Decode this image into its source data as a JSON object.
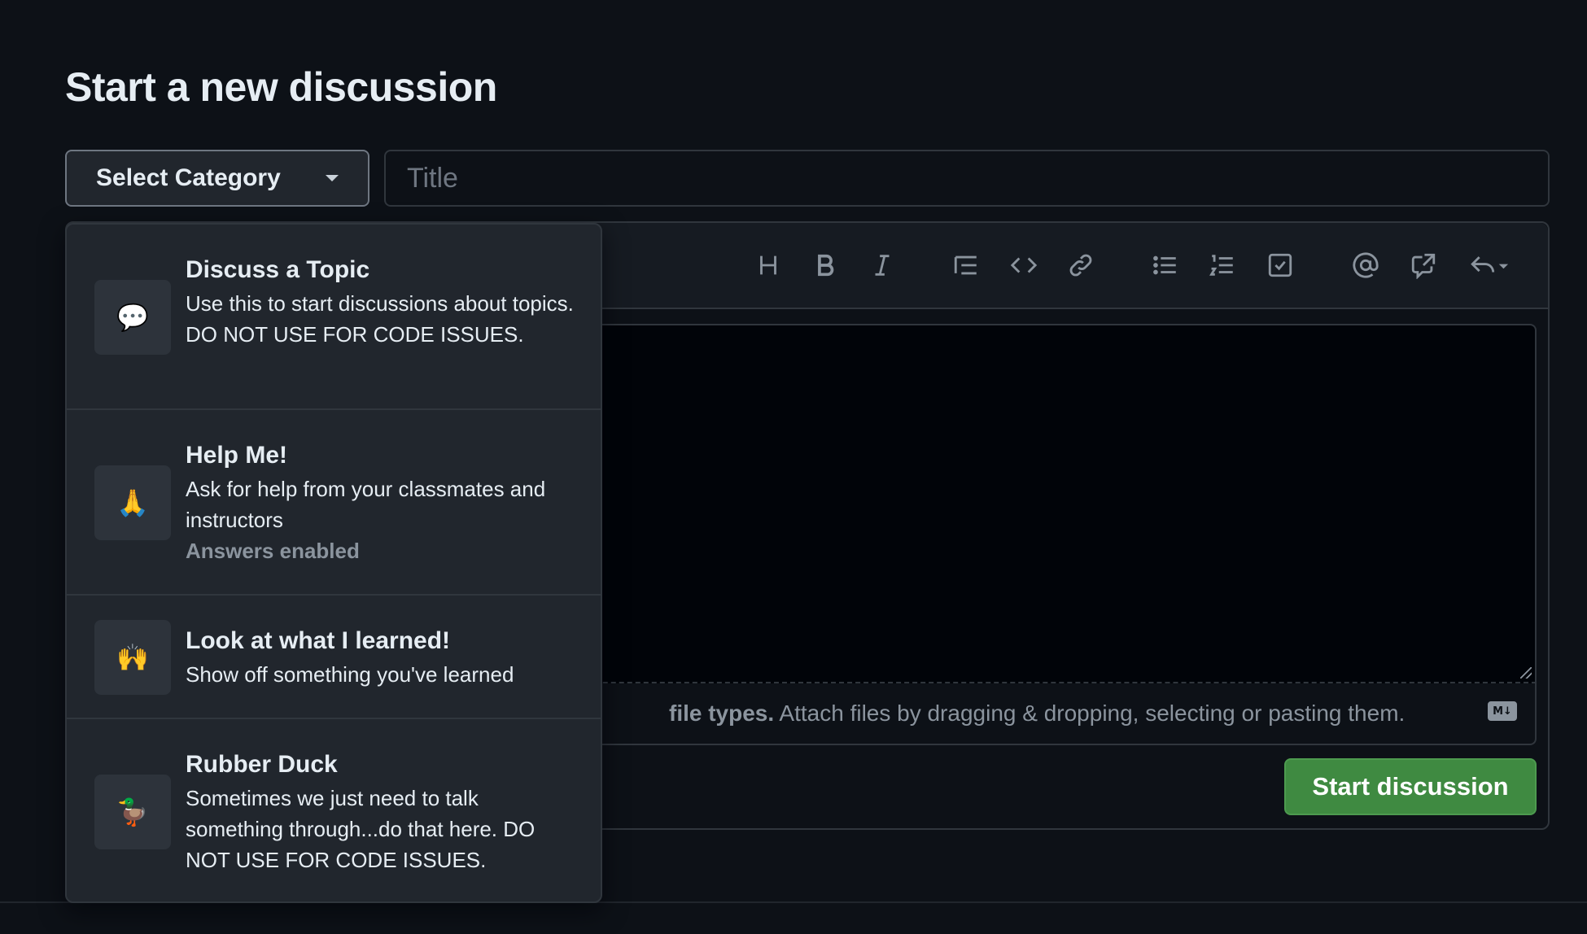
{
  "page": {
    "title": "Start a new discussion"
  },
  "form": {
    "category_button_label": "Select Category",
    "title_placeholder": "Title",
    "submit_label": "Start discussion"
  },
  "toolbar": {
    "tools": [
      "heading-icon",
      "bold-icon",
      "italic-icon",
      "quote-icon",
      "code-icon",
      "link-icon",
      "unordered-list-icon",
      "ordered-list-icon",
      "task-list-icon",
      "mention-icon",
      "reference-icon",
      "reply-icon"
    ]
  },
  "attachment": {
    "bold_text": "file types.",
    "text": "Attach files by dragging & dropping, selecting or pasting them.",
    "markdown_badge": "M↓"
  },
  "categories": [
    {
      "emoji": "💬",
      "name": "Discuss a Topic",
      "description": "Use this to start discussions about topics. DO NOT USE FOR CODE ISSUES.",
      "note": ""
    },
    {
      "emoji": "🙏",
      "name": "Help Me!",
      "description": "Ask for help from your classmates and instructors",
      "note": "Answers enabled"
    },
    {
      "emoji": "🙌",
      "name": "Look at what I learned!",
      "description": "Show off something you've learned",
      "note": ""
    },
    {
      "emoji": "🦆",
      "name": "Rubber Duck",
      "description": "Sometimes we just need to talk something through...do that here. DO NOT USE FOR CODE ISSUES.",
      "note": ""
    }
  ],
  "colors": {
    "background": "#0d1117",
    "surface": "#21262d",
    "border": "#30363d",
    "primary_button": "#3f8a41",
    "muted_text": "#8b949e"
  }
}
